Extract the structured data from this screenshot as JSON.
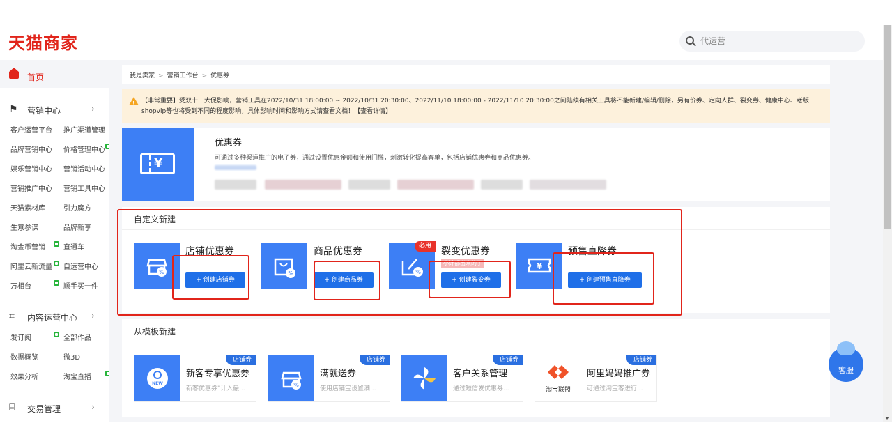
{
  "header": {
    "logo": "天猫商家",
    "search_placeholder": "代运营"
  },
  "sidebar": {
    "home": "首页",
    "marketing": {
      "label": "营销中心",
      "items": [
        "客户运营平台",
        "推广渠道管理",
        "品牌营销中心",
        "价格管理中心",
        "娱乐营销中心",
        "营销活动中心",
        "营销推广中心",
        "营销工具中心",
        "天猫素材库",
        "引力魔方",
        "生意参谋",
        "品牌新享",
        "淘金币营销",
        "直通车",
        "阿里云新流量",
        "自运营中心",
        "万相台",
        "顺手买一件"
      ]
    },
    "content": {
      "label": "内容运营中心",
      "items": [
        "发订阅",
        "全部作品",
        "数据概览",
        "微3D",
        "效果分析",
        "淘宝直播"
      ]
    },
    "trade": {
      "label": "交易管理"
    }
  },
  "breadcrumb": [
    "我是卖家",
    "营销工作台",
    "优惠券"
  ],
  "notice": "【非常重要】受双十一大促影响，营销工具在2022/10/31 18:00:00 ~ 2022/10/31 20:30:00、2022/11/10 18:00:00 - 2022/11/10 20:30:00之间陆续有相关工具将不能新建/编辑/删除，另有价券、定向人群、裂变券、健康中心、老版shopvip等也将受到不同的程度影响，具体影响时间和影响方式请查看文档！【查看详情】",
  "intro": {
    "title": "优惠券",
    "desc": "可通过多种渠道推广的电子券，通过设置优惠金额和使用门槛，刺激转化提高客单，包括店铺优惠券和商品优惠券。"
  },
  "custom": {
    "title": "自定义新建",
    "options": [
      {
        "title": "店铺优惠券",
        "button": "+ 创建店铺券"
      },
      {
        "title": "商品优惠券",
        "button": "+ 创建商品券"
      },
      {
        "title": "裂变优惠券",
        "button": "+ 创建裂变券",
        "badge": "必用",
        "tag": "小计都出来的了"
      },
      {
        "title": "预售直降券",
        "button": "+ 创建预售直降券"
      }
    ]
  },
  "templates": {
    "title": "从模板新建",
    "items": [
      {
        "title": "新客专享优惠券",
        "desc": "新客优惠券\"计入最...",
        "tag": "店铺券",
        "icon_text": "NEW"
      },
      {
        "title": "满就送券",
        "desc": "使用店铺宝设置满...",
        "tag": "店铺券"
      },
      {
        "title": "客户关系管理",
        "desc": "通过短信发优惠券...",
        "tag": "店铺券"
      },
      {
        "title": "阿里妈妈推广券",
        "desc": "可通过淘宝客进行...",
        "tag": "店铺券",
        "icon_text": "淘宝联盟"
      }
    ]
  },
  "chat": "客服",
  "colors": {
    "brand_red": "#e1251b",
    "primary_blue": "#3d7ff5",
    "button_blue": "#1f6fe8"
  }
}
